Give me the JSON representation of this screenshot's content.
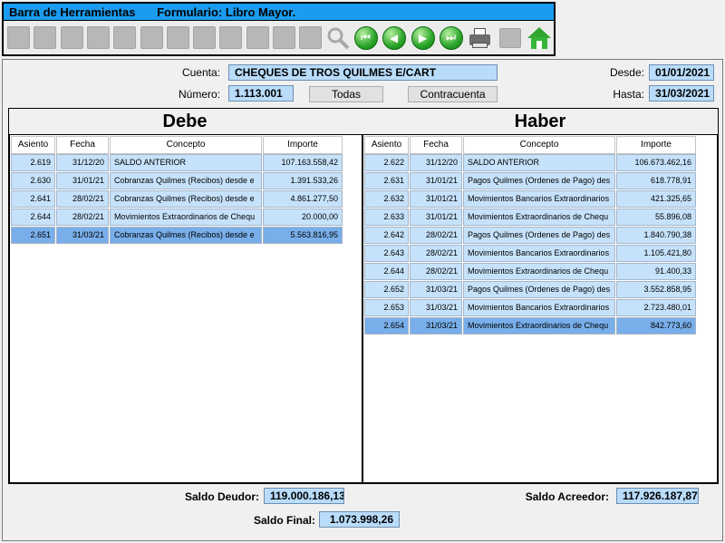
{
  "toolbar": {
    "title": "Barra de Herramientas",
    "form_title": "Formulario: Libro Mayor.",
    "buttons": [
      {
        "name": "toolbar-new-icon"
      },
      {
        "name": "toolbar-save-icon"
      },
      {
        "name": "toolbar-save-as-icon"
      },
      {
        "name": "toolbar-edit-icon"
      },
      {
        "name": "toolbar-delete-icon"
      },
      {
        "name": "toolbar-undo-icon"
      },
      {
        "name": "toolbar-redo-icon"
      },
      {
        "name": "toolbar-film-icon"
      },
      {
        "name": "toolbar-insert-icon"
      },
      {
        "name": "toolbar-list-icon"
      },
      {
        "name": "toolbar-table-icon"
      },
      {
        "name": "toolbar-search-icon"
      }
    ],
    "nav": {
      "first": "⏮",
      "prev": "◀",
      "next": "▶",
      "last": "⏭"
    }
  },
  "header": {
    "cuenta_label": "Cuenta:",
    "cuenta_value": "CHEQUES DE TROS QUILMES E/CART",
    "numero_label": "Número:",
    "numero_value": "1.113.001",
    "todas_button": "Todas",
    "contracuenta_button": "Contracuenta",
    "desde_label": "Desde:",
    "desde_value": "01/01/2021",
    "hasta_label": "Hasta:",
    "hasta_value": "31/03/2021"
  },
  "columns": {
    "asiento": "Asiento",
    "fecha": "Fecha",
    "concepto": "Concepto",
    "importe": "Importe"
  },
  "debe": {
    "title": "Debe",
    "rows": [
      {
        "asiento": "2.619",
        "fecha": "31/12/20",
        "concepto": "SALDO ANTERIOR",
        "importe": "107.163.558,42"
      },
      {
        "asiento": "2.630",
        "fecha": "31/01/21",
        "concepto": "Cobranzas Quilmes (Recibos) desde e",
        "importe": "1.391.533,26"
      },
      {
        "asiento": "2.641",
        "fecha": "28/02/21",
        "concepto": "Cobranzas Quilmes (Recibos) desde e",
        "importe": "4.861.277,50"
      },
      {
        "asiento": "2.644",
        "fecha": "28/02/21",
        "concepto": "Movimientos Extraordinarios de Chequ",
        "importe": "20.000,00"
      },
      {
        "asiento": "2.651",
        "fecha": "31/03/21",
        "concepto": "Cobranzas Quilmes (Recibos) desde e",
        "importe": "5.563.816,95",
        "selected": true
      }
    ]
  },
  "haber": {
    "title": "Haber",
    "rows": [
      {
        "asiento": "2.622",
        "fecha": "31/12/20",
        "concepto": "SALDO ANTERIOR",
        "importe": "106.673.462,16"
      },
      {
        "asiento": "2.631",
        "fecha": "31/01/21",
        "concepto": "Pagos Quilmes (Ordenes de Pago) des",
        "importe": "618.778,91"
      },
      {
        "asiento": "2.632",
        "fecha": "31/01/21",
        "concepto": "Movimientos Bancarios Extraordinarios",
        "importe": "421.325,65"
      },
      {
        "asiento": "2.633",
        "fecha": "31/01/21",
        "concepto": "Movimientos Extraordinarios de Chequ",
        "importe": "55.896,08"
      },
      {
        "asiento": "2.642",
        "fecha": "28/02/21",
        "concepto": "Pagos Quilmes (Ordenes de Pago) des",
        "importe": "1.840.790,38"
      },
      {
        "asiento": "2.643",
        "fecha": "28/02/21",
        "concepto": "Movimientos Bancarios Extraordinarios",
        "importe": "1.105.421,80"
      },
      {
        "asiento": "2.644",
        "fecha": "28/02/21",
        "concepto": "Movimientos Extraordinarios de Chequ",
        "importe": "91.400,33"
      },
      {
        "asiento": "2.652",
        "fecha": "31/03/21",
        "concepto": "Pagos Quilmes (Ordenes de Pago) des",
        "importe": "3.552.858,95"
      },
      {
        "asiento": "2.653",
        "fecha": "31/03/21",
        "concepto": "Movimientos Bancarios Extraordinarios",
        "importe": "2.723.480,01"
      },
      {
        "asiento": "2.654",
        "fecha": "31/03/21",
        "concepto": "Movimientos Extraordinarios de Chequ",
        "importe": "842.773,60",
        "selected": true
      }
    ]
  },
  "totals": {
    "saldo_deudor_label": "Saldo Deudor:",
    "saldo_deudor_value": "119.000.186,13",
    "saldo_acreedor_label": "Saldo Acreedor:",
    "saldo_acreedor_value": "117.926.187,87",
    "saldo_final_label": "Saldo Final:",
    "saldo_final_value": "1.073.998,26"
  },
  "colors": {
    "titlebar": "#1a9cf0",
    "field_bg": "#b9dcfa",
    "row_bg": "#c6e2fb",
    "row_selected": "#78aeea"
  }
}
